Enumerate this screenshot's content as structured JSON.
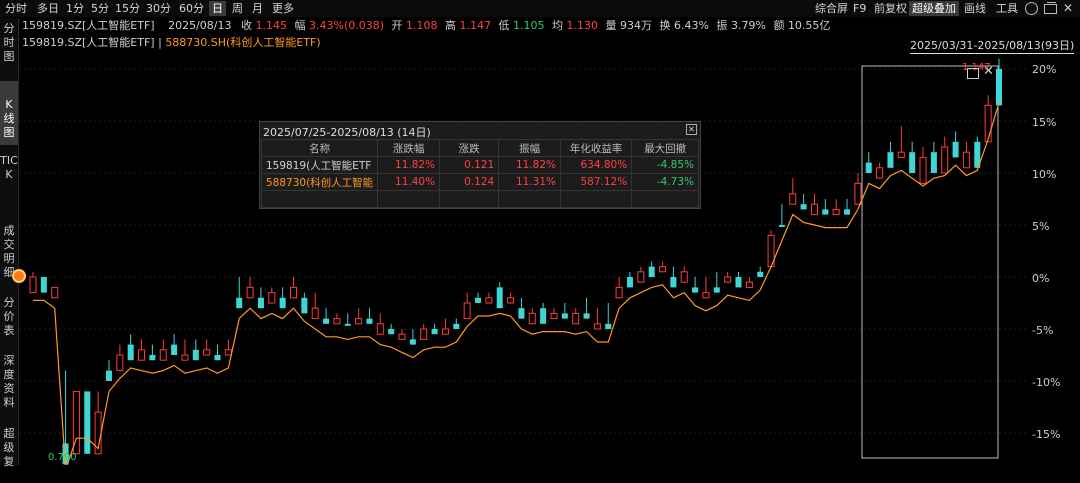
{
  "toolbar": {
    "periods": [
      "分时",
      "多日",
      "1分",
      "5分",
      "15分",
      "30分",
      "60分",
      "日",
      "周",
      "月",
      "更多"
    ],
    "active_period": "日",
    "right": [
      "综合屏",
      "F9",
      "前复权",
      "超级叠加",
      "画线",
      "工具"
    ],
    "right_active": "超级叠加"
  },
  "sidetabs": [
    "分时图",
    "K线图",
    "TICK",
    "成交明细",
    "分价表",
    "深度资料",
    "超级复"
  ],
  "quote": {
    "symbol": "159819.SZ[人工智能ETF]",
    "date": "2025/08/13",
    "close_label": "收",
    "close": "1.145",
    "change_label": "幅",
    "change": "3.43%(0.038)",
    "open_label": "开",
    "open": "1.108",
    "high_label": "高",
    "high": "1.147",
    "low_label": "低",
    "low": "1.105",
    "avg_label": "均",
    "avg": "1.130",
    "vol_label": "量",
    "vol": "934万",
    "turn_label": "换",
    "turn": "6.43%",
    "amp_label": "振",
    "amp": "3.79%",
    "amt_label": "额",
    "amt": "10.55亿"
  },
  "overlay_legend": {
    "main": "159819.SZ[人工智能ETF]",
    "sep": "|",
    "overlay": "588730.SH(科创人工智能ETF)"
  },
  "range_label": "2025/03/31-2025/08/13(93日)",
  "popup": {
    "title": "2025/07/25-2025/08/13 (14日)",
    "headers": [
      "名称",
      "涨跌幅",
      "涨跌",
      "振幅",
      "年化收益率",
      "最大回撤"
    ],
    "rows": [
      {
        "name": "159819(人工智能ETF",
        "chg_pct": "11.82%",
        "chg": "0.121",
        "amp": "11.82%",
        "annual": "634.80%",
        "mdd": "-4.85%"
      },
      {
        "name": "588730(科创人工智能",
        "chg_pct": "11.40%",
        "chg": "0.124",
        "amp": "11.31%",
        "annual": "587.12%",
        "mdd": "-4.73%"
      }
    ]
  },
  "price_marks": {
    "high": "1.147",
    "low": "0.790"
  },
  "chart_data": {
    "type": "line",
    "y_ticks": [
      "20%",
      "15%",
      "10%",
      "5%",
      "0%",
      "-5%",
      "-10%",
      "-15%"
    ],
    "candles_pct": [
      [
        0,
        0.5,
        -1,
        -1.5
      ],
      [
        0,
        -1,
        -1.5,
        -1.5
      ],
      [
        -1,
        -1.5,
        -1.5,
        -2
      ],
      [
        -16,
        -9,
        -17,
        -18
      ],
      [
        -11,
        -13,
        -16,
        -17
      ],
      [
        -11,
        -14,
        -16,
        -17
      ],
      [
        -13,
        -11,
        -16,
        -17
      ],
      [
        -9,
        -8,
        -10,
        -10
      ],
      [
        -7.5,
        -6.5,
        -9,
        -9
      ],
      [
        -6.5,
        -5.5,
        -8,
        -8
      ],
      [
        -7,
        -6,
        -8,
        -8
      ],
      [
        -7.5,
        -6.5,
        -8,
        -8
      ],
      [
        -7,
        -6,
        -8,
        -8
      ],
      [
        -6.5,
        -5.5,
        -7.5,
        -7.5
      ],
      [
        -7.5,
        -6,
        -8,
        -8
      ],
      [
        -7,
        -6,
        -8,
        -8
      ],
      [
        -7,
        -6,
        -7.5,
        -7.5
      ],
      [
        -7.5,
        -6.5,
        -8,
        -8
      ],
      [
        -7,
        -6,
        -7.5,
        -7.5
      ],
      [
        -2,
        0,
        -3,
        -3
      ],
      [
        -1,
        0,
        -2,
        -2
      ],
      [
        -2,
        -1,
        -3,
        -3
      ],
      [
        -1.5,
        -1,
        -2.5,
        -2.5
      ],
      [
        -2,
        -1,
        -3,
        -3
      ],
      [
        -1,
        0,
        -2,
        -2
      ],
      [
        -2,
        -1.5,
        -3.5,
        -3.5
      ],
      [
        -3,
        -1.5,
        -4,
        -4
      ],
      [
        -4,
        -3,
        -4.5,
        -4.5
      ],
      [
        -4,
        -3.5,
        -4.5,
        -4.5
      ],
      [
        -4.5,
        -3.5,
        -4.5,
        -4.5
      ],
      [
        -4,
        -3,
        -4.5,
        -4.5
      ],
      [
        -4,
        -3,
        -4.5,
        -4.5
      ],
      [
        -4.5,
        -3.5,
        -5.5,
        -5.5
      ],
      [
        -5,
        -4.5,
        -5.5,
        -5.5
      ],
      [
        -5.5,
        -5,
        -6,
        -6
      ],
      [
        -6,
        -5,
        -6.5,
        -6.5
      ],
      [
        -5,
        -4.5,
        -6,
        -6
      ],
      [
        -5,
        -4.5,
        -5.5,
        -5.5
      ],
      [
        -5,
        -4,
        -5.5,
        -5.5
      ],
      [
        -4.5,
        -4,
        -5,
        -5
      ],
      [
        -2.5,
        -1.5,
        -4,
        -4
      ],
      [
        -2,
        -1.5,
        -2.5,
        -2.5
      ],
      [
        -2,
        -1.5,
        -2.5,
        -2.5
      ],
      [
        -1,
        -0.5,
        -3,
        -3
      ],
      [
        -2,
        -1.5,
        -2.5,
        -2.5
      ],
      [
        -3,
        -2,
        -4,
        -4
      ],
      [
        -3.5,
        -3,
        -4.5,
        -4.5
      ],
      [
        -3,
        -2.5,
        -4.5,
        -4.5
      ],
      [
        -3.5,
        -3,
        -4,
        -4
      ],
      [
        -3.5,
        -2.5,
        -4,
        -4
      ],
      [
        -3.5,
        -3,
        -4.5,
        -4.5
      ],
      [
        -3.5,
        -2,
        -4,
        -4
      ],
      [
        -4.5,
        -3,
        -5,
        -5
      ],
      [
        -4.5,
        -2.5,
        -5,
        -5
      ],
      [
        -1,
        0,
        -2,
        -2
      ],
      [
        0,
        0.5,
        -1,
        -1
      ],
      [
        0.5,
        1,
        -0.5,
        -0.5
      ],
      [
        1,
        1.5,
        0,
        0
      ],
      [
        1,
        1.5,
        0.5,
        0.5
      ],
      [
        0,
        1,
        -1,
        -1
      ],
      [
        0.5,
        1,
        -0.5,
        -0.5
      ],
      [
        -1,
        0,
        -1.5,
        -1.5
      ],
      [
        -1.5,
        0,
        -2,
        -2
      ],
      [
        -1,
        0.5,
        -1.5,
        -1.5
      ],
      [
        0,
        0.5,
        -0.5,
        -0.5
      ],
      [
        0,
        0.5,
        -1,
        -1
      ],
      [
        -0.5,
        0,
        -1,
        -1
      ],
      [
        0.5,
        1,
        0,
        0
      ],
      [
        4,
        4.5,
        1,
        1
      ],
      [
        5,
        7,
        5,
        5
      ],
      [
        8,
        9.5,
        7,
        7
      ],
      [
        7,
        8,
        6.5,
        6.5
      ],
      [
        7,
        8,
        6,
        6
      ],
      [
        6.5,
        7.5,
        6,
        6
      ],
      [
        6.5,
        7.5,
        6,
        6
      ],
      [
        6.5,
        7.5,
        6,
        6
      ],
      [
        9,
        10,
        7,
        7
      ],
      [
        11,
        12,
        10,
        10
      ],
      [
        10.5,
        11,
        9.5,
        9.5
      ],
      [
        12,
        13,
        10.5,
        10.5
      ],
      [
        12,
        14.5,
        11.5,
        11.5
      ],
      [
        12,
        13,
        10,
        10
      ],
      [
        11.5,
        12.5,
        9,
        9
      ],
      [
        12,
        13,
        10,
        10
      ],
      [
        12.5,
        13.5,
        10,
        10
      ],
      [
        13,
        14,
        11.5,
        11.5
      ],
      [
        12,
        13,
        10.5,
        10.5
      ],
      [
        13,
        13.5,
        10.5,
        10.5
      ],
      [
        16.5,
        17.5,
        13,
        13
      ],
      [
        20,
        21,
        16.5,
        16.5
      ]
    ]
  }
}
